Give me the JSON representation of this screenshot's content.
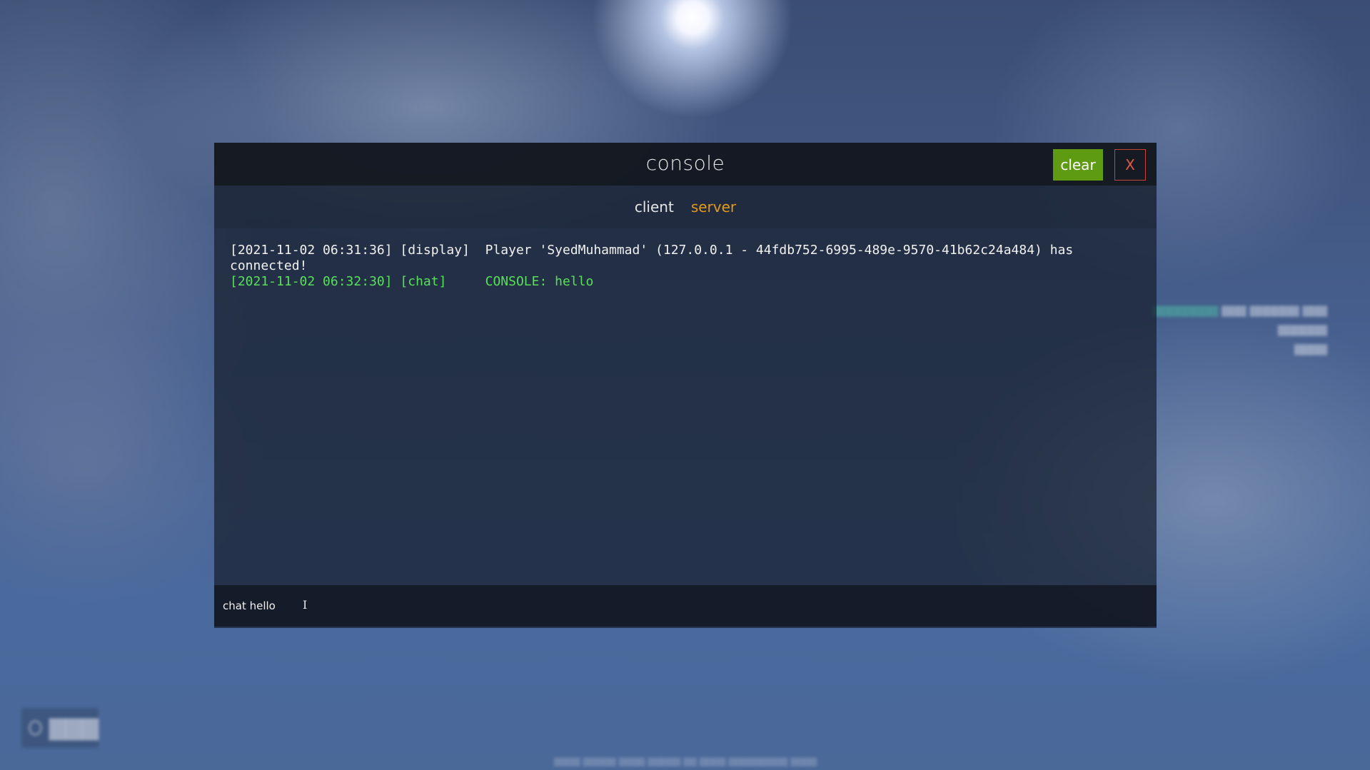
{
  "console": {
    "title": "console",
    "clear_label": "clear",
    "close_label": "X",
    "tabs": [
      {
        "label": "client",
        "active": false
      },
      {
        "label": "server",
        "active": true
      }
    ],
    "log": [
      {
        "text": "[2021-11-02 06:31:36] [display]  Player 'SyedMuhammad' (127.0.0.1 - 44fdb752-6995-489e-9570-41b62c24a484) has connected!",
        "type": "display"
      },
      {
        "text": "[2021-11-02 06:32:30] [chat]     CONSOLE: hello",
        "type": "chat"
      }
    ],
    "input": {
      "value": "chat hello",
      "placeholder": ""
    }
  },
  "colors": {
    "accent_green": "#5e9a12",
    "close_red": "#c44536",
    "active_tab": "#e39a1c",
    "chat_text": "#58e05a"
  },
  "icons": {
    "cursor": "text-cursor-icon"
  }
}
